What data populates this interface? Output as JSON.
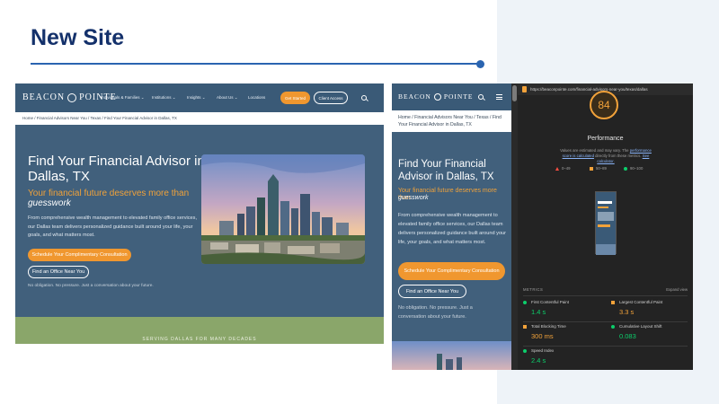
{
  "slide": {
    "title": "New Site",
    "accent_color": "#14316b"
  },
  "desktop": {
    "logo": {
      "left": "BEACON",
      "right": "POINTE"
    },
    "nav": {
      "items": [
        "Individuals & Families ⌄",
        "Institutions ⌄",
        "Insights ⌄",
        "About Us ⌄",
        "Locations"
      ],
      "get_started": "Get Started",
      "client_access": "Client Access",
      "icon": "search-icon"
    },
    "breadcrumb": "Home  /  Financial Advisors Near You  /  Texas  /  Find Your Financial Advisor in Dallas, TX",
    "hero": {
      "heading": "Find Your Financial Advisor in Dallas, TX",
      "tagline": "Your financial future deserves more than",
      "tagline_em": "guesswork",
      "body": "From comprehensive wealth management to elevated family office services, our Dallas team delivers personalized guidance built around your life, your goals, and what matters most.",
      "cta_primary": "Schedule Your Complimentary Consultation",
      "cta_secondary": "Find an Office Near You",
      "note": "No obligation. No pressure. Just a conversation about your future."
    },
    "footer_band": "SERVING DALLAS FOR MANY DECADES"
  },
  "mobile": {
    "logo": {
      "left": "BEACON",
      "right": "POINTE"
    },
    "icons": [
      "search-icon",
      "menu-icon"
    ],
    "breadcrumb": "Home  /  Financial Advisors Near You  /  Texas  /  Find Your Financial Advisor in Dallas, TX",
    "hero": {
      "heading": "Find Your Financial Advisor in Dallas, TX",
      "tagline": "Your financial future deserves more than",
      "tagline_em": "guesswork",
      "body": "From comprehensive wealth management to elevated family office services, our Dallas team delivers personalized guidance built around your life, your goals, and what matters most.",
      "cta_primary": "Schedule Your Complimentary Consultation",
      "cta_secondary": "Find an Office Near You",
      "note": "No obligation. No pressure. Just a conversation about your future."
    }
  },
  "lighthouse": {
    "url": "https://beaconpointe.com/financial-advisors-near-you/texas/dallas",
    "score": "84",
    "score_color": "#f2a23a",
    "category": "Performance",
    "note_pre": "Values are estimated and may vary. The",
    "note_link1": "performance score is calculated",
    "note_mid": "directly from these metrics.",
    "note_link2": "See calculator.",
    "legend": [
      "0–49",
      "50–89",
      "90–100"
    ],
    "metrics_header": "METRICS",
    "expand": "Expand view",
    "metrics": [
      {
        "name": "First Contentful Paint",
        "value": "1.4 s",
        "status": "good"
      },
      {
        "name": "Largest Contentful Paint",
        "value": "3.3 s",
        "status": "average"
      },
      {
        "name": "Total Blocking Time",
        "value": "300 ms",
        "status": "average"
      },
      {
        "name": "Cumulative Layout Shift",
        "value": "0.083",
        "status": "good"
      },
      {
        "name": "Speed Index",
        "value": "2.4 s",
        "status": "good"
      }
    ]
  }
}
